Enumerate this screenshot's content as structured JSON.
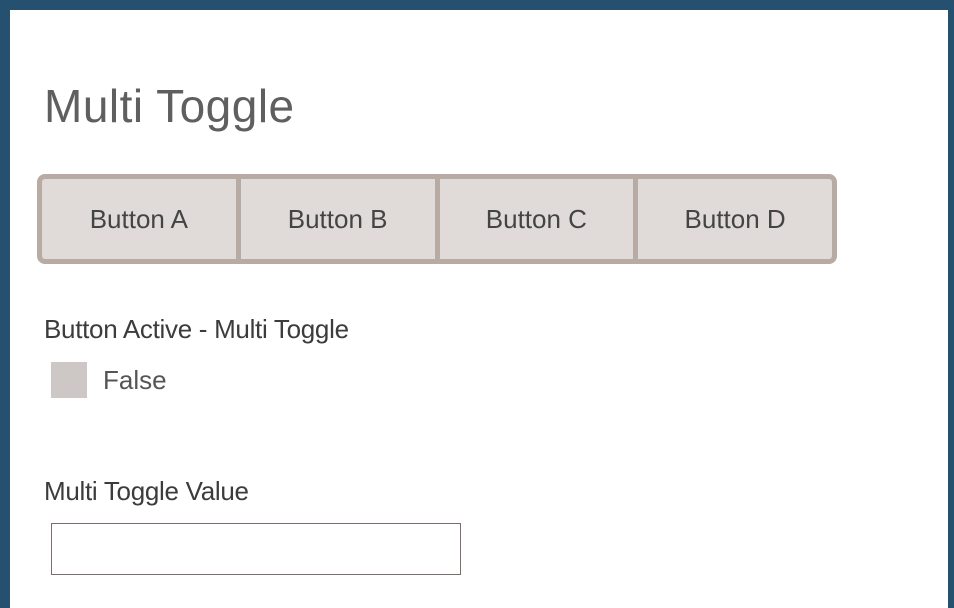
{
  "page": {
    "title": "Multi Toggle"
  },
  "toggle_group": {
    "buttons": [
      {
        "label": "Button A"
      },
      {
        "label": "Button B"
      },
      {
        "label": "Button C"
      },
      {
        "label": "Button D"
      }
    ]
  },
  "button_active": {
    "label": "Button Active - Multi Toggle",
    "legend_value": "False",
    "swatch_color": "#cdc7c5"
  },
  "toggle_value": {
    "label": "Multi Toggle Value",
    "value": "",
    "placeholder": ""
  },
  "colors": {
    "frame": "#25506f",
    "button_bg": "#e0dbd8",
    "button_border": "#b8aba3"
  }
}
